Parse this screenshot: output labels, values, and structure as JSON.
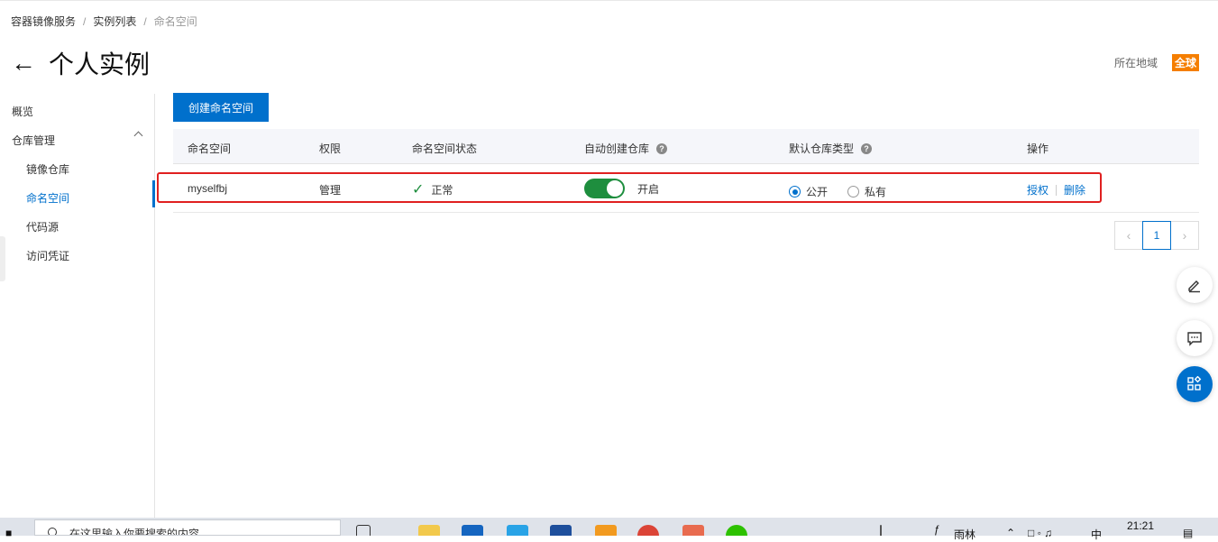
{
  "breadcrumb": [
    "容器镜像服务",
    "实例列表",
    "命名空间"
  ],
  "title": "个人实例",
  "region": {
    "label": "所在地域",
    "value": "全球"
  },
  "sidebar": {
    "items": [
      {
        "label": "概览"
      },
      {
        "label": "仓库管理"
      },
      {
        "label": "镜像仓库"
      },
      {
        "label": "命名空间",
        "active": true
      },
      {
        "label": "代码源"
      },
      {
        "label": "访问凭证"
      }
    ]
  },
  "create_button": "创建命名空间",
  "table": {
    "headers": [
      "命名空间",
      "权限",
      "命名空间状态",
      "自动创建仓库",
      "默认仓库类型",
      "操作"
    ],
    "rows": [
      {
        "name": "myselfbj",
        "permission": "管理",
        "status": "正常",
        "auto_create": {
          "on": true,
          "label": "开启"
        },
        "repo_type": {
          "options": [
            "公开",
            "私有"
          ],
          "selected": "公开"
        },
        "actions": [
          "授权",
          "删除"
        ]
      }
    ]
  },
  "pagination": {
    "current": "1"
  },
  "taskbar": {
    "search_placeholder": "在这里输入你要搜索的内容",
    "weather": "雨林",
    "ime": "中",
    "time": "21:21"
  },
  "colors": {
    "primary": "#0070cc",
    "success": "#1e8e3e",
    "highlight": "#e02020",
    "region_badge": "#f57e00"
  }
}
